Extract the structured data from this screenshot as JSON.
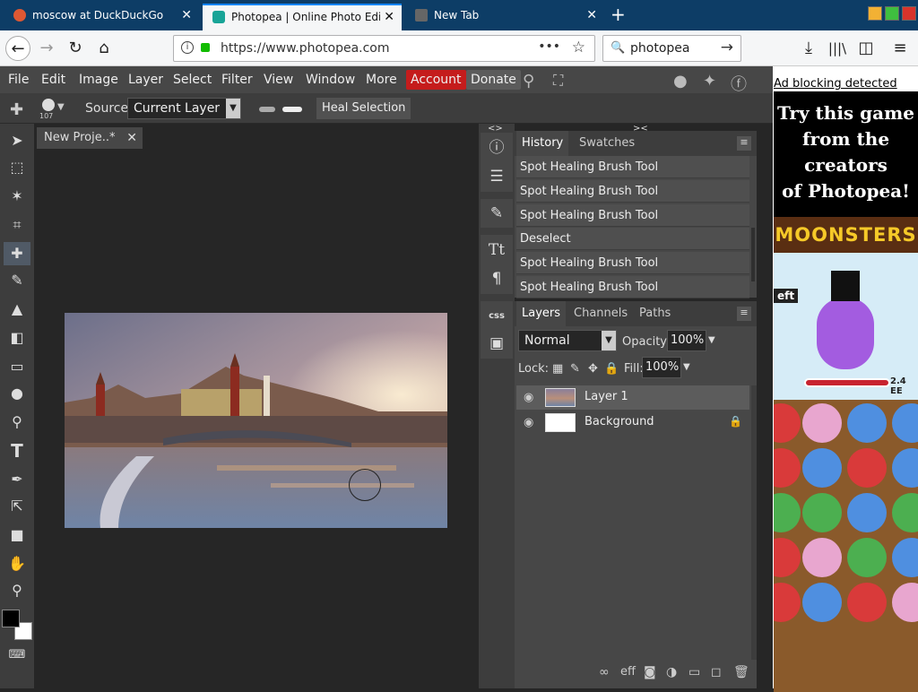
{
  "browser": {
    "tabs": [
      {
        "title": "moscow at DuckDuckGo",
        "active": false
      },
      {
        "title": "Photopea | Online Photo Edit",
        "active": true
      },
      {
        "title": "New Tab",
        "active": false
      }
    ],
    "url": "https://www.photopea.com",
    "search_value": "photopea",
    "new_tab_glyph": "+",
    "close_glyph": "✕"
  },
  "menubar": {
    "items": [
      "File",
      "Edit",
      "Image",
      "Layer",
      "Select",
      "Filter",
      "View",
      "Window",
      "More"
    ],
    "account": "Account",
    "donate": "Donate"
  },
  "options": {
    "brush_size": "107",
    "source_label": "Source:",
    "source_value": "Current Layer",
    "heal_button": "Heal Selection"
  },
  "document": {
    "tab_title": "New Proje..*"
  },
  "history": {
    "tabs": [
      "History",
      "Swatches"
    ],
    "items": [
      "Spot Healing Brush Tool",
      "Spot Healing Brush Tool",
      "Spot Healing Brush Tool",
      "Deselect",
      "Spot Healing Brush Tool",
      "Spot Healing Brush Tool"
    ]
  },
  "layers": {
    "tabs": [
      "Layers",
      "Channels",
      "Paths"
    ],
    "blend_mode": "Normal",
    "opacity_label": "Opacity:",
    "opacity": "100%",
    "lock_label": "Lock:",
    "fill_label": "Fill:",
    "fill": "100%",
    "items": [
      {
        "name": "Layer 1",
        "selected": true
      },
      {
        "name": "Background",
        "selected": false,
        "locked": true
      }
    ],
    "footer_label": "eff"
  },
  "iconcol": {
    "css_label": "css"
  },
  "ad": {
    "adblock_text": "Ad blocking detected",
    "promo_line1": "Try this game",
    "promo_line2": "from the",
    "promo_line3": "creators",
    "promo_line4": "of Photopea!",
    "game_title": "MOONSTERS",
    "left_label": "eft",
    "score": "2.4 EE"
  },
  "colors": {
    "accent_account": "#c51c1c",
    "tab_highlight": "#0a84ff",
    "panel_bg": "#474747"
  }
}
